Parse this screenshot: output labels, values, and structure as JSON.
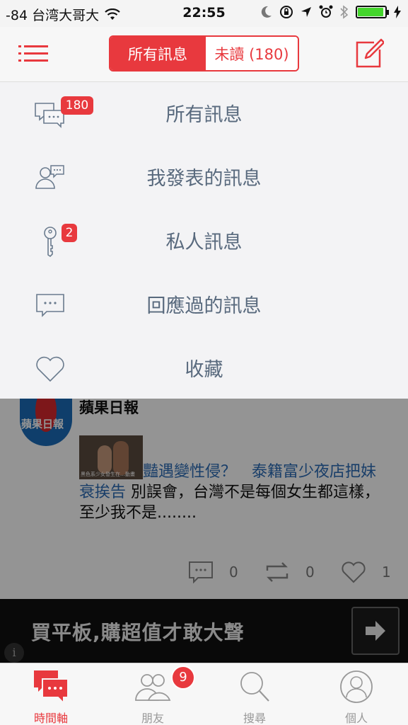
{
  "status_bar": {
    "carrier": "-84 台湾大哥大",
    "time": "22:55",
    "battery_level": 0.95
  },
  "nav": {
    "segment_all": "所有訊息",
    "segment_unread": "未讀 (180)"
  },
  "dropdown": {
    "items": [
      {
        "label": "所有訊息",
        "icon": "chat-bubbles-icon",
        "badge": "180"
      },
      {
        "label": "我發表的訊息",
        "icon": "user-message-icon",
        "badge": ""
      },
      {
        "label": "私人訊息",
        "icon": "key-icon",
        "badge": "2"
      },
      {
        "label": "回應過的訊息",
        "icon": "comment-icon",
        "badge": ""
      },
      {
        "label": "收藏",
        "icon": "heart-icon",
        "badge": ""
      }
    ]
  },
  "post": {
    "author": "蘋果日報",
    "avatar_text": "蘋果日報",
    "thumb_caption": "黑色系少女發生在…動畫",
    "headline": "豔遇變性侵？　泰籍富少夜店把妹衰挨告",
    "body": " 別誤會，台灣不是每個女生都這樣，至少我不是........",
    "comments": "0",
    "reposts": "0",
    "likes": "1"
  },
  "ad": {
    "text": "買平板,購超值才敢大聲",
    "info": "i"
  },
  "tabs": [
    {
      "label": "時間軸",
      "icon": "timeline-icon",
      "active": true,
      "badge": ""
    },
    {
      "label": "朋友",
      "icon": "friends-icon",
      "active": false,
      "badge": "9"
    },
    {
      "label": "搜尋",
      "icon": "search-icon",
      "active": false,
      "badge": ""
    },
    {
      "label": "個人",
      "icon": "profile-icon",
      "active": false,
      "badge": ""
    }
  ],
  "colors": {
    "accent": "#e8393e",
    "menu_text": "#58697d",
    "link": "#2b6cb5"
  }
}
